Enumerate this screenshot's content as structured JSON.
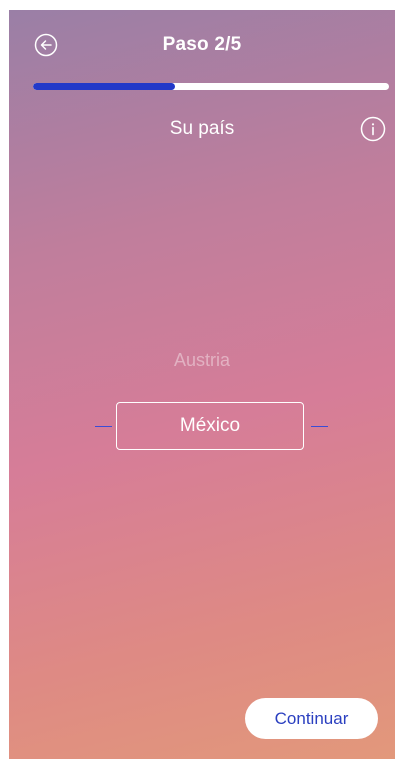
{
  "header": {
    "back_icon": "arrow-left-circle-icon",
    "step_title": "Paso 2/5",
    "progress_fraction": 0.4
  },
  "question": {
    "heading": "Su país",
    "info_icon": "info-circle-icon"
  },
  "picker": {
    "previous_option": "Austria",
    "selected_option": "México"
  },
  "footer": {
    "continue_label": "Continuar"
  },
  "colors": {
    "accent": "#2239c9",
    "button_text": "#2a3fc0",
    "gradient_top": "#9a7fa6",
    "gradient_middle": "#d67d98",
    "gradient_bottom": "#e2987b"
  }
}
